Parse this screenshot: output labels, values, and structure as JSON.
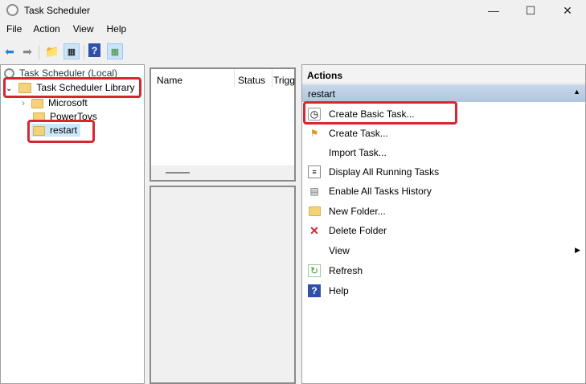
{
  "window": {
    "title": "Task Scheduler",
    "controls": [
      "minimize",
      "maximize",
      "close"
    ]
  },
  "menu": [
    "File",
    "Action",
    "View",
    "Help"
  ],
  "toolbar": [
    "back-icon",
    "forward-icon",
    "up-folder-icon",
    "show-hide-console-tree-icon",
    "help-icon",
    "show-hide-action-pane-icon"
  ],
  "tree": {
    "root": "Task Scheduler (Local)",
    "library": "Task Scheduler Library",
    "children": [
      "Microsoft",
      "PowerToys",
      "restart"
    ],
    "selected": "restart"
  },
  "list": {
    "columns": [
      "Name",
      "Status",
      "Trigg"
    ]
  },
  "actions": {
    "header": "Actions",
    "section": "restart",
    "items": [
      {
        "label": "Create Basic Task...",
        "icon": "create-basic-task-icon"
      },
      {
        "label": "Create Task...",
        "icon": "create-task-icon"
      },
      {
        "label": "Import Task...",
        "icon": ""
      },
      {
        "label": "Display All Running Tasks",
        "icon": "running-tasks-icon"
      },
      {
        "label": "Enable All Tasks History",
        "icon": "history-icon"
      },
      {
        "label": "New Folder...",
        "icon": "new-folder-icon"
      },
      {
        "label": "Delete Folder",
        "icon": "delete-icon"
      },
      {
        "label": "View",
        "icon": "",
        "submenu": true
      },
      {
        "label": "Refresh",
        "icon": "refresh-icon"
      },
      {
        "label": "Help",
        "icon": "help-icon"
      }
    ]
  },
  "colors": {
    "highlight": "#d9262e",
    "section_bar": "#b9cde3",
    "selected": "#cce8ff"
  }
}
